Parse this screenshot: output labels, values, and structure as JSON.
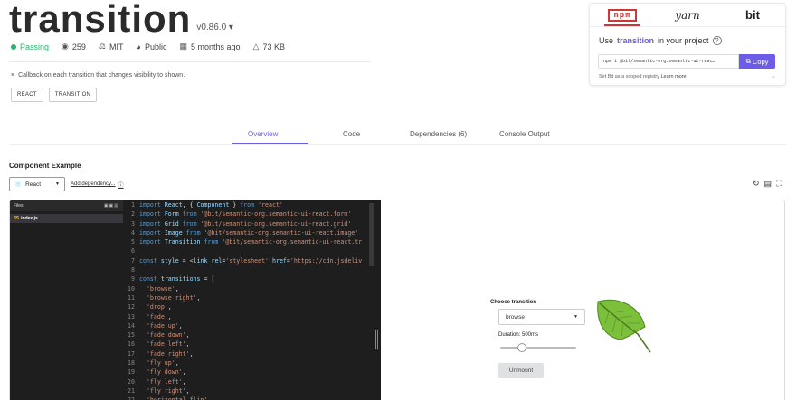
{
  "header": {
    "title": "transition",
    "version": "v0.86.0 ▾",
    "meta": {
      "status": "Passing",
      "dependents": "259",
      "license": "MIT",
      "visibility": "Public",
      "updated": "5 months ago",
      "size": "73 KB"
    },
    "description": "Callback on each transition that changes visibility to shown.",
    "tags": [
      "REACT",
      "TRANSITION"
    ]
  },
  "install": {
    "tabs": [
      "npm",
      "yarn",
      "bit"
    ],
    "use_prefix": "Use",
    "use_name": "transition",
    "use_suffix": "in your project",
    "command": "npm i @bit/semantic-org.semantic-ui-reac…",
    "copy_label": "Copy",
    "scoped_text": "Set Bit as a scoped registry",
    "learn_more": "Learn more"
  },
  "tabs": [
    {
      "label": "Overview",
      "active": true
    },
    {
      "label": "Code",
      "active": false
    },
    {
      "label": "Dependencies (6)",
      "active": false
    },
    {
      "label": "Console Output",
      "active": false
    }
  ],
  "example": {
    "section_title": "Component Example",
    "framework": "React",
    "add_dependency": "Add dependency...",
    "files_label": "Files",
    "file_name": "index.js"
  },
  "code_lines": [
    [
      "1",
      "import React, { Component } from 'react'"
    ],
    [
      "2",
      "import Form from '@bit/semantic-org.semantic-ui-react.form'"
    ],
    [
      "3",
      "import Grid from '@bit/semantic-org.semantic-ui-react.grid'"
    ],
    [
      "4",
      "import Image from '@bit/semantic-org.semantic-ui-react.image'"
    ],
    [
      "5",
      "import Transition from '@bit/semantic-org.semantic-ui-react.tr"
    ],
    [
      "6",
      ""
    ],
    [
      "7",
      "const style = <link rel='stylesheet' href='https://cdn.jsdeliv"
    ],
    [
      "8",
      ""
    ],
    [
      "9",
      "const transitions = ["
    ],
    [
      "10",
      "  'browse',"
    ],
    [
      "11",
      "  'browse right',"
    ],
    [
      "12",
      "  'drop',"
    ],
    [
      "13",
      "  'fade',"
    ],
    [
      "14",
      "  'fade up',"
    ],
    [
      "15",
      "  'fade down',"
    ],
    [
      "16",
      "  'fade left',"
    ],
    [
      "17",
      "  'fade right',"
    ],
    [
      "18",
      "  'fly up',"
    ],
    [
      "19",
      "  'fly down',"
    ],
    [
      "20",
      "  'fly left',"
    ],
    [
      "21",
      "  'fly right',"
    ],
    [
      "22",
      "  'horizontal flip',"
    ]
  ],
  "preview": {
    "choose_label": "Choose transition",
    "selected": "browse",
    "duration_label": "Duration: 500ms",
    "duration_fraction": 0.25,
    "unmount_label": "Unmount"
  },
  "colors": {
    "accent": "#6c5ce7",
    "passing": "#2fb36b",
    "npm": "#cb3837"
  }
}
